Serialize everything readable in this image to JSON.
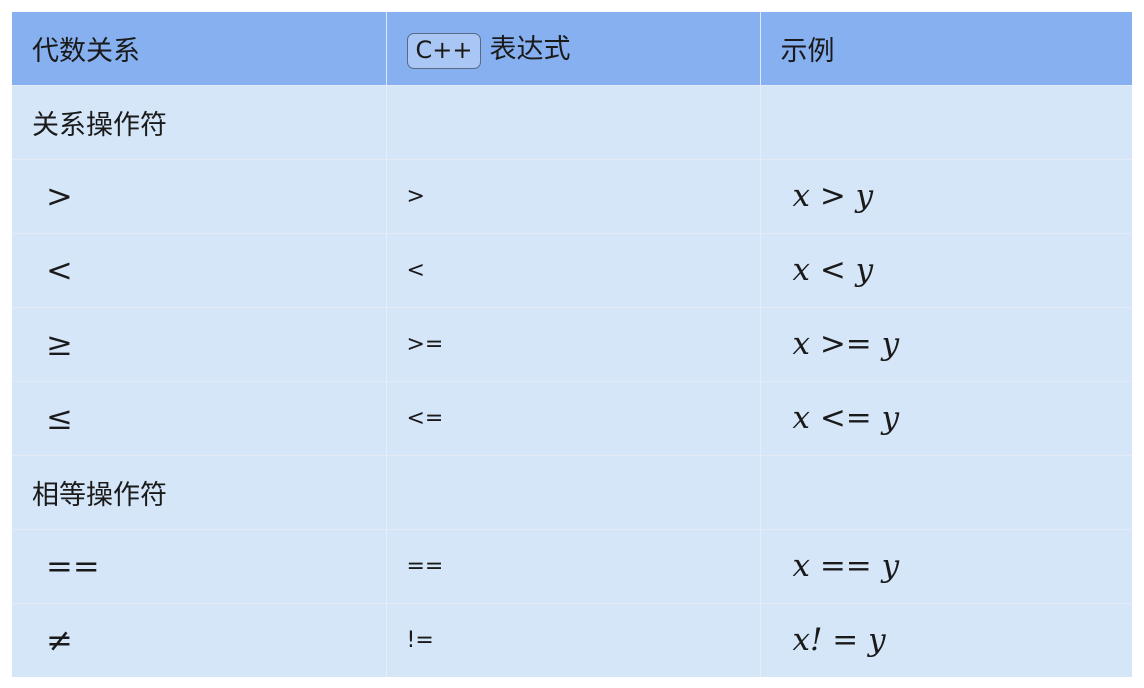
{
  "header": {
    "col1": "代数关系",
    "col2_code": "C++",
    "col2_text": "表达式",
    "col3": "示例"
  },
  "sections": [
    {
      "label": "关系操作符",
      "rows": [
        {
          "math": ">",
          "cpp": ">",
          "example": "x > y"
        },
        {
          "math": "<",
          "cpp": "<",
          "example": "x < y"
        },
        {
          "math": "≥",
          "cpp": ">=",
          "example": "x >= y"
        },
        {
          "math": "≤",
          "cpp": "<=",
          "example": "x <= y"
        }
      ]
    },
    {
      "label": "相等操作符",
      "rows": [
        {
          "math": "==",
          "cpp": "==",
          "example": "x == y"
        },
        {
          "math": "≠",
          "cpp": "!=",
          "example": "x! = y"
        }
      ]
    }
  ]
}
